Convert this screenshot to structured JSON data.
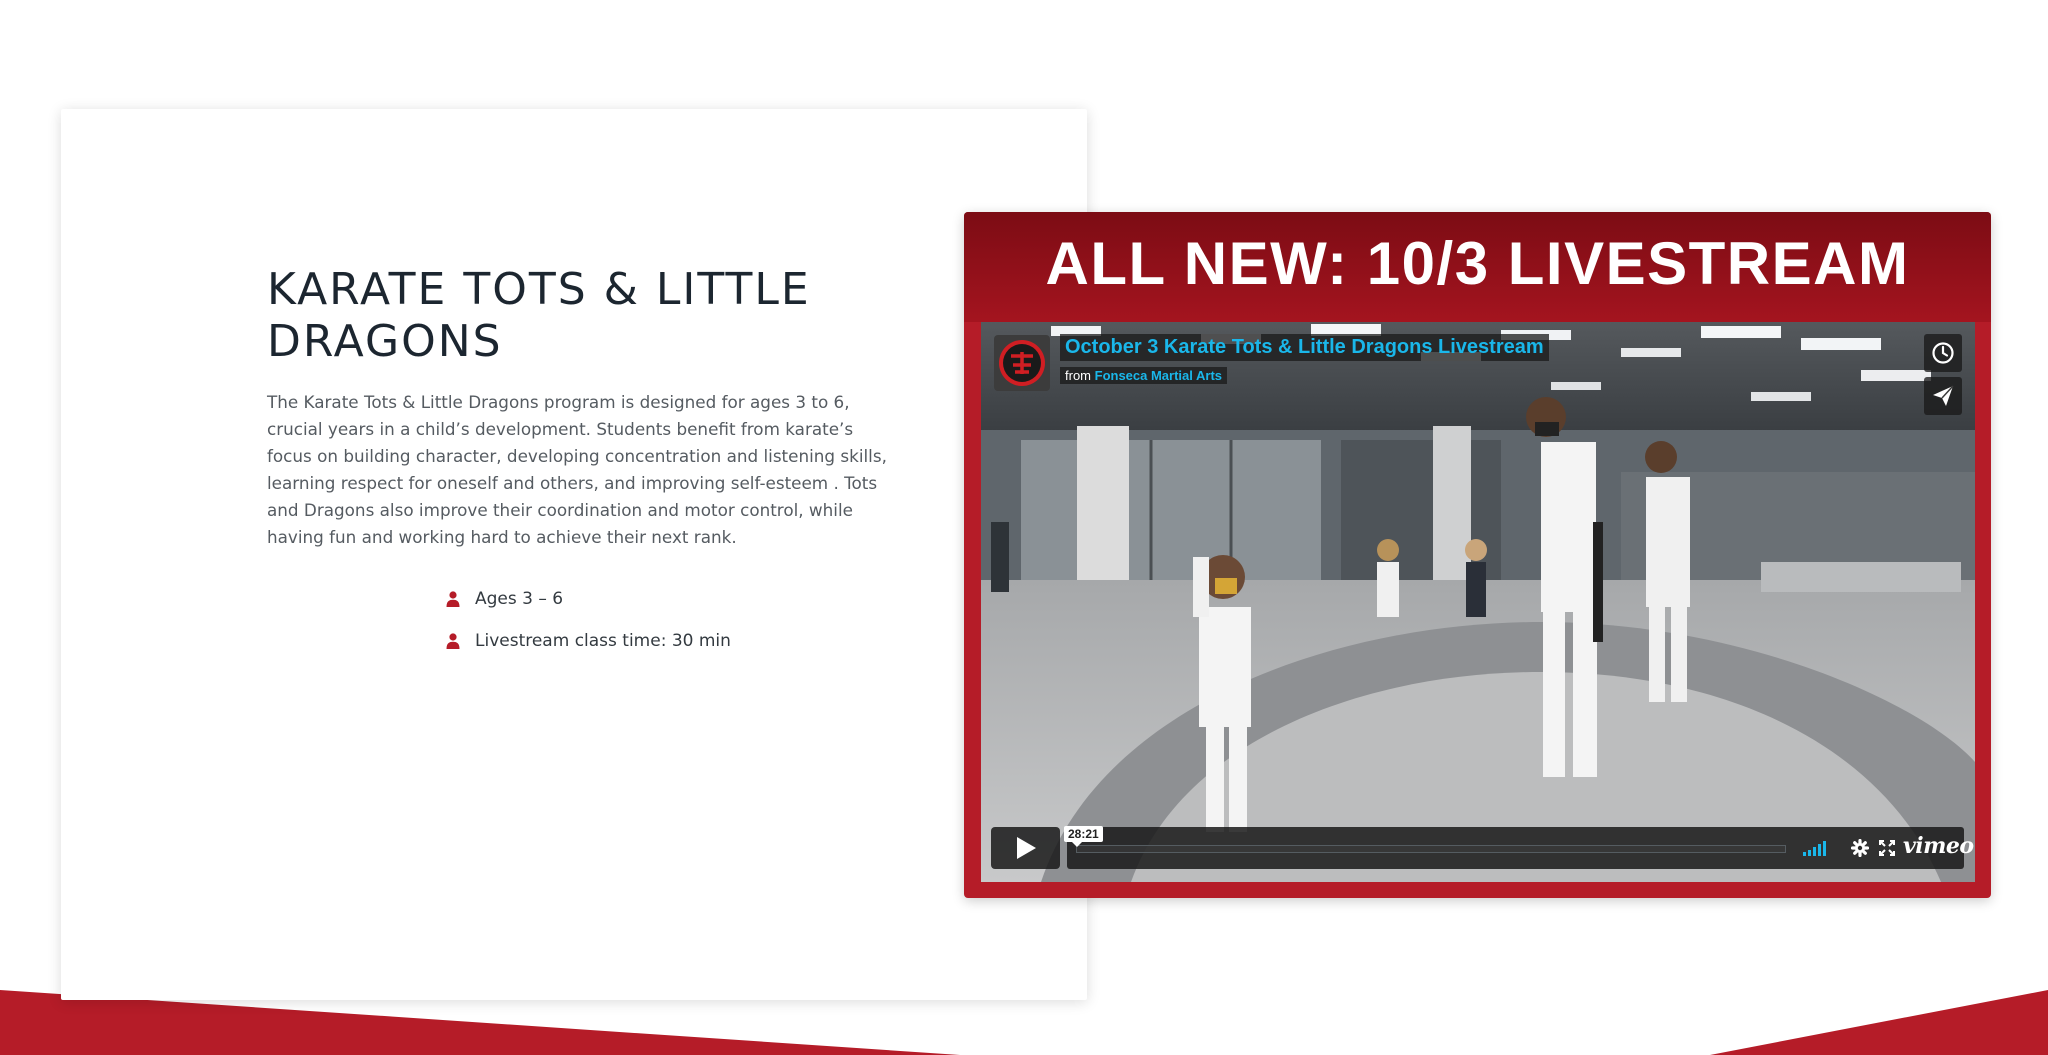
{
  "theme": {
    "accent": "#b51c28",
    "banner_top": "#7c0c14",
    "vimeo_blue": "#1ab7ea",
    "text_dark": "#1c2630",
    "text_body": "#555b61"
  },
  "program": {
    "title": "KARATE TOTS & LITTLE DRAGONS",
    "description": "The Karate Tots & Little Dragons program is designed for ages 3 to 6, crucial years in a child’s development. Students benefit from karate’s focus on building character, developing concentration  and listening skills, learning respect for oneself and others, and improving self-esteem . Tots and Dragons also improve their coordination and  motor control, while having fun and working hard to achieve their next rank.",
    "features": [
      {
        "icon": "user-icon",
        "text": "Ages 3 – 6"
      },
      {
        "icon": "user-icon",
        "text": "Livestream class time: 30 min"
      }
    ]
  },
  "video": {
    "banner": "ALL NEW: 10/3 LIVESTREAM",
    "title": "October 3 Karate Tots & Little Dragons Livestream",
    "byline_prefix": "from",
    "channel": "Fonseca Martial Arts",
    "duration": "28:21",
    "player_brand": "vimeo",
    "icons": [
      "clock-icon",
      "paper-plane-icon",
      "play-icon",
      "volume-icon",
      "gear-icon",
      "fullscreen-icon",
      "vimeo-logo"
    ]
  }
}
